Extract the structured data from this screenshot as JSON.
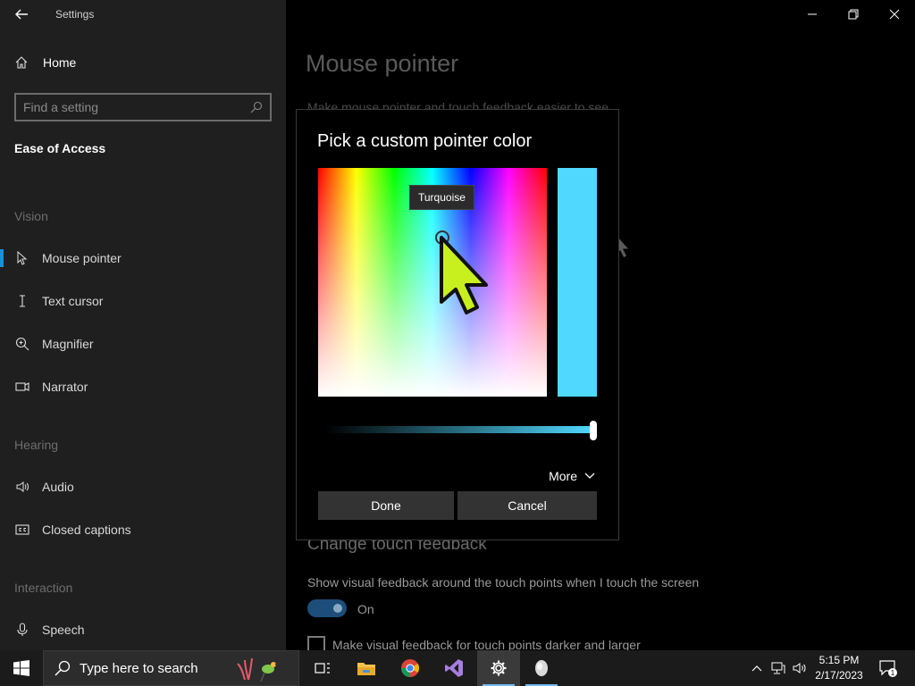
{
  "window": {
    "title": "Settings",
    "back_icon": "back-arrow-icon",
    "controls": [
      "minimize-icon",
      "restore-icon",
      "close-icon"
    ]
  },
  "sidebar": {
    "home_label": "Home",
    "search_placeholder": "Find a setting",
    "section_title": "Ease of Access",
    "groups": [
      {
        "label": "Vision"
      },
      {
        "label": "Hearing"
      },
      {
        "label": "Interaction"
      }
    ],
    "items": [
      {
        "label": "Mouse pointer",
        "icon": "mouse-pointer-icon",
        "active": true
      },
      {
        "label": "Text cursor",
        "icon": "text-cursor-icon"
      },
      {
        "label": "Magnifier",
        "icon": "magnifier-icon"
      },
      {
        "label": "Narrator",
        "icon": "narrator-icon"
      },
      {
        "label": "Audio",
        "icon": "audio-icon"
      },
      {
        "label": "Closed captions",
        "icon": "closed-captions-icon"
      },
      {
        "label": "Speech",
        "icon": "microphone-icon"
      }
    ]
  },
  "main": {
    "title": "Mouse pointer",
    "subtitle": "Make mouse pointer and touch feedback easier to see",
    "touch_heading": "Change touch feedback",
    "touch_desc": "Show visual feedback around the touch points when I touch the screen",
    "toggle_state": "On",
    "checkbox_label": "Make visual feedback for touch points darker and larger"
  },
  "dialog": {
    "title": "Pick a custom pointer color",
    "tooltip": "Turquoise",
    "selected_color": "#50d8ff",
    "slider_value": 1.0,
    "more_label": "More",
    "done_label": "Done",
    "cancel_label": "Cancel",
    "pointer_color": "#c8f01e"
  },
  "taskbar": {
    "search_placeholder": "Type here to search",
    "apps": [
      "task-view-icon",
      "file-explorer-icon",
      "chrome-icon",
      "visual-studio-icon",
      "settings-icon",
      "pointer-app-icon"
    ],
    "time": "5:15 PM",
    "date": "2/17/2023",
    "notification_count": "1"
  },
  "colors": {
    "accent": "#1a8fd6",
    "sidebar_bg": "#1f1f1f",
    "taskbar_bg": "#1b1b1b"
  }
}
